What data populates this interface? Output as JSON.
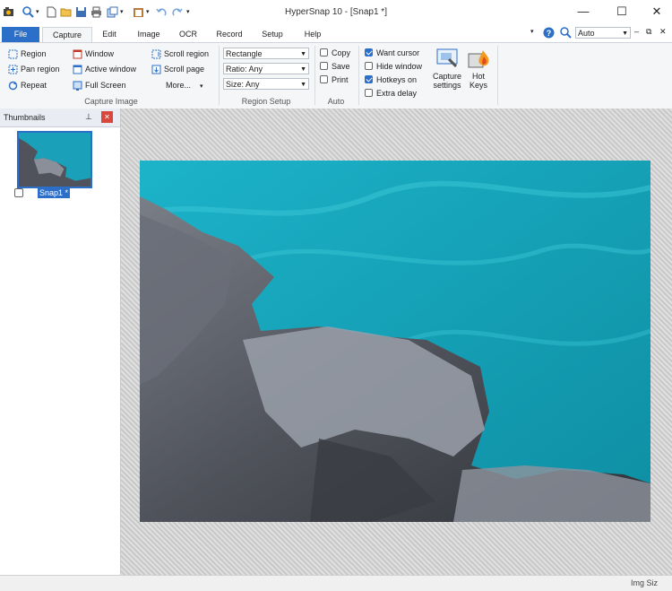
{
  "window": {
    "title": "HyperSnap 10 - [Snap1 *]",
    "minimize": "—",
    "maximize": "☐",
    "close": "✕"
  },
  "tabs": [
    "File",
    "Capture",
    "Edit",
    "Image",
    "OCR",
    "Record",
    "Setup",
    "Help"
  ],
  "tabs_right": {
    "zoom_value": "Auto"
  },
  "ribbon": {
    "capture_image": {
      "label": "Capture Image",
      "region": "Region",
      "pan_region": "Pan region",
      "repeat": "Repeat",
      "window": "Window",
      "active_window": "Active window",
      "full_screen": "Full Screen",
      "scroll_region": "Scroll region",
      "scroll_page": "Scroll page",
      "more": "More..."
    },
    "region_setup": {
      "label": "Region Setup",
      "shape": "Rectangle",
      "ratio": "Ratio: Any",
      "size": "Size: Any"
    },
    "auto": {
      "label": "Auto",
      "copy": "Copy",
      "save": "Save",
      "print": "Print"
    },
    "options": {
      "want_cursor": "Want cursor",
      "hide_window": "Hide window",
      "hotkeys_on": "Hotkeys on",
      "extra_delay": "Extra delay",
      "want_cursor_checked": true,
      "hide_window_checked": false,
      "hotkeys_on_checked": true,
      "extra_delay_checked": false
    },
    "capture_settings": "Capture settings",
    "hot_keys": "Hot Keys"
  },
  "thumbnails": {
    "title": "Thumbnails",
    "items": [
      {
        "label": "Snap1 *"
      }
    ]
  },
  "status": {
    "img_size": "Img Siz"
  },
  "colors": {
    "accent": "#2b6fc9",
    "water": "#1aa0b8",
    "rock": "#5a5d66"
  }
}
